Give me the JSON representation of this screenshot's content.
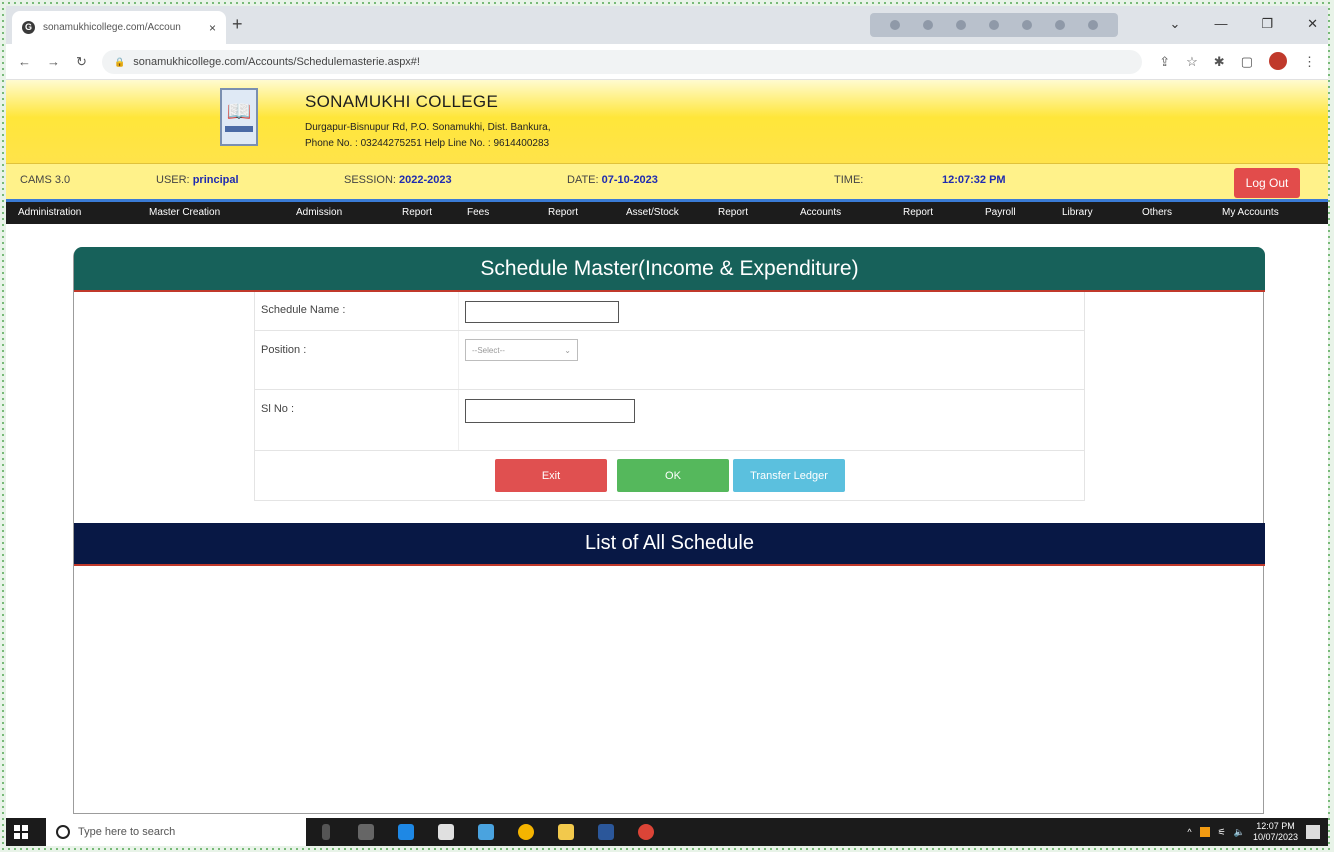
{
  "browser": {
    "tab_title": "sonamukhicollege.com/Accoun",
    "url": "sonamukhicollege.com/Accounts/Schedulemasterie.aspx#!",
    "tab_close": "×",
    "new_tab": "+",
    "window_controls": [
      "⌄",
      "—",
      "❐",
      "✕"
    ]
  },
  "college": {
    "name": "SONAMUKHI COLLEGE",
    "address": "Durgapur-Bisnupur Rd, P.O. Sonamukhi, Dist. Bankura,",
    "phone": "Phone No. : 03244275251  Help Line No. : 9614400283"
  },
  "infobar": {
    "cams_label": "CAMS 3.0",
    "user_label": "USER:",
    "user_value": "principal",
    "session_label": "SESSION:",
    "session_value": "2022-2023",
    "date_label": "DATE:",
    "date_value": "07-10-2023",
    "time_label": "TIME:",
    "time_value": "12:07:32 PM",
    "logout_label": "Log Out"
  },
  "menu": [
    "Administration",
    "Master Creation",
    "Admission",
    "Report",
    "Fees",
    "Report",
    "Asset/Stock",
    "Report",
    "Accounts",
    "Report",
    "Payroll",
    "Library",
    "Others",
    "My Accounts"
  ],
  "form": {
    "title": "Schedule Master(Income & Expenditure)",
    "schedule_name_label": "Schedule Name :",
    "schedule_name_value": "",
    "position_label": "Position :",
    "position_selected": "--Select--",
    "sl_no_label": "Sl No :",
    "sl_no_value": "",
    "exit_label": "Exit",
    "ok_label": "OK",
    "transfer_label": "Transfer Ledger"
  },
  "list": {
    "title": "List of All Schedule"
  },
  "taskbar": {
    "search_placeholder": "Type here to search",
    "time": "12:07 PM",
    "date": "10/07/2023"
  },
  "colors": {
    "form_header": "#17615a",
    "list_header": "#081845",
    "exit_button": "#e05050",
    "ok_button": "#55b85c",
    "transfer_button": "#5bc0de",
    "logout_button": "#e24c4b",
    "banner": "#ffe63a"
  }
}
